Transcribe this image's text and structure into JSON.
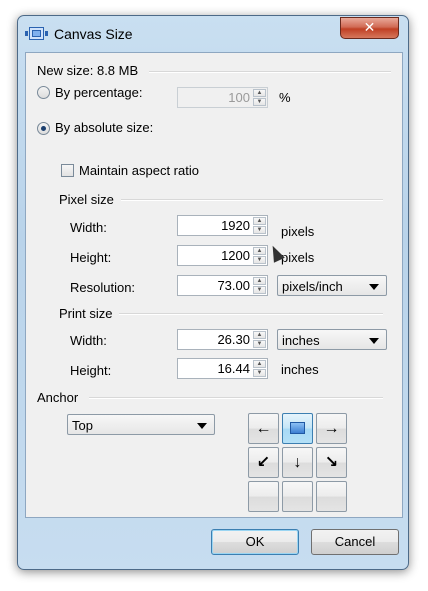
{
  "window": {
    "title": "Canvas Size",
    "close_glyph": "✕"
  },
  "summary": {
    "new_size": "New size: 8.8 MB"
  },
  "mode": {
    "percentage_label": "By percentage:",
    "percentage_value": "100",
    "percentage_unit": "%",
    "absolute_label": "By absolute size:",
    "selected": "absolute"
  },
  "aspect": {
    "label": "Maintain aspect ratio",
    "checked": false
  },
  "pixel_size": {
    "heading": "Pixel size",
    "width_label": "Width:",
    "width_value": "1920",
    "width_unit": "pixels",
    "height_label": "Height:",
    "height_value": "1200",
    "height_unit": "pixels",
    "resolution_label": "Resolution:",
    "resolution_value": "73.00",
    "resolution_unit": "pixels/inch"
  },
  "print_size": {
    "heading": "Print size",
    "width_label": "Width:",
    "width_value": "26.30",
    "width_unit": "inches",
    "height_label": "Height:",
    "height_value": "16.44",
    "height_unit": "inches"
  },
  "anchor": {
    "heading": "Anchor",
    "position": "Top",
    "arrows": [
      "←",
      "",
      "→",
      "↙",
      "↓",
      "↘",
      "",
      "",
      ""
    ]
  },
  "buttons": {
    "ok": "OK",
    "cancel": "Cancel"
  },
  "icons": {
    "app": "canvas-size-icon",
    "close": "close-icon",
    "spin": "spin-arrows-icon",
    "dropdown": "chevron-down-icon",
    "cursor": "mouse-pointer-icon"
  },
  "colors": {
    "titlebar": "#b9d3ea",
    "close_button": "#c04024",
    "dialog": "#f0f0f0",
    "selected_anchor": "#a7d9f5"
  }
}
